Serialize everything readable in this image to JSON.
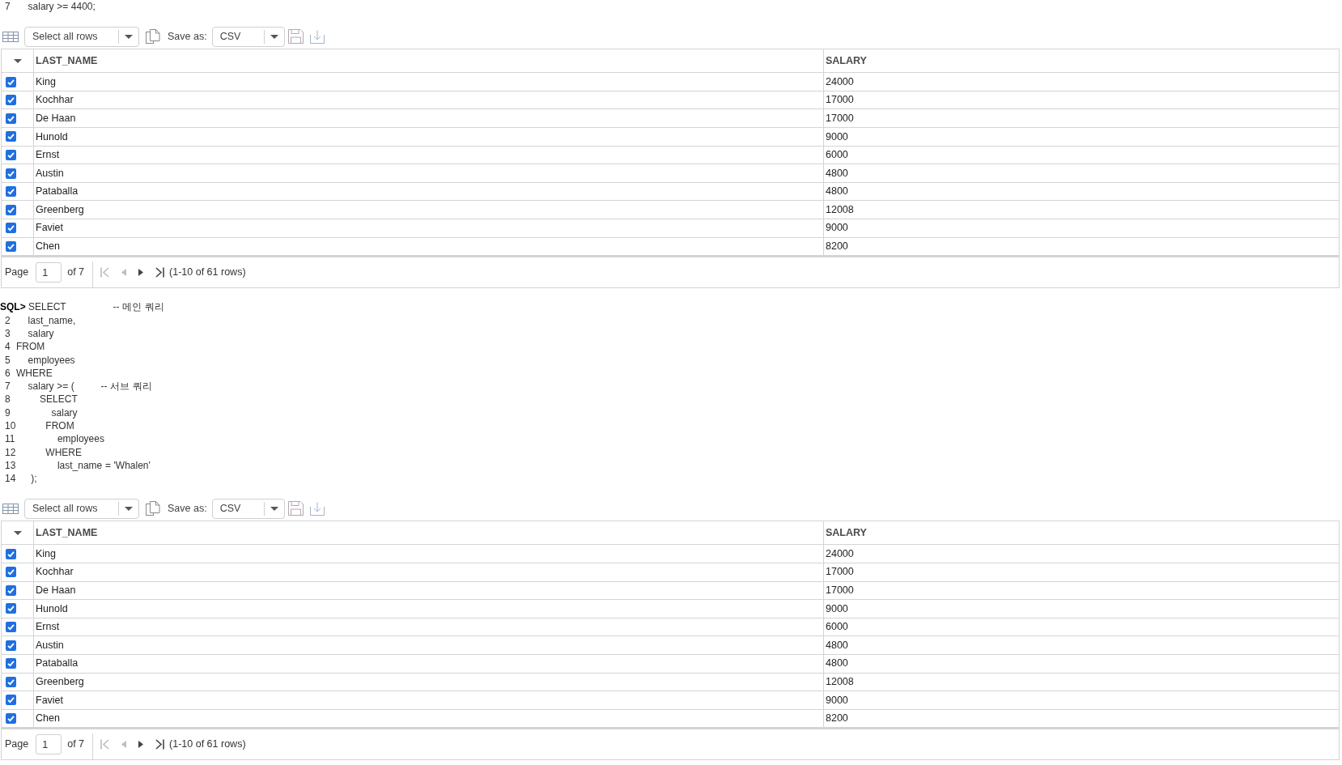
{
  "sections": [
    {
      "kind": "code",
      "lines": [
        {
          "kind": "numbered",
          "number": "7",
          "code": "    salary >= 4400;"
        }
      ]
    },
    {
      "kind": "result",
      "toolbar": {
        "row_selection": "Select all rows",
        "save_as_label": "Save as:",
        "save_format": "CSV"
      },
      "table": {
        "columns": [
          {
            "label": "LAST_NAME"
          },
          {
            "label": "SALARY"
          }
        ],
        "rows": [
          {
            "checked": true,
            "cells": [
              "King",
              "24000"
            ]
          },
          {
            "checked": true,
            "cells": [
              "Kochhar",
              "17000"
            ]
          },
          {
            "checked": true,
            "cells": [
              "De Haan",
              "17000"
            ]
          },
          {
            "checked": true,
            "cells": [
              "Hunold",
              "9000"
            ]
          },
          {
            "checked": true,
            "cells": [
              "Ernst",
              "6000"
            ]
          },
          {
            "checked": true,
            "cells": [
              "Austin",
              "4800"
            ]
          },
          {
            "checked": true,
            "cells": [
              "Pataballa",
              "4800"
            ]
          },
          {
            "checked": true,
            "cells": [
              "Greenberg",
              "12008"
            ]
          },
          {
            "checked": true,
            "cells": [
              "Faviet",
              "9000"
            ]
          },
          {
            "checked": true,
            "cells": [
              "Chen",
              "8200"
            ]
          }
        ]
      },
      "pagination": {
        "page_label": "Page",
        "page_value": "1",
        "page_total": "of 7",
        "nav": [
          {
            "kind": "first",
            "disabled": true
          },
          {
            "kind": "previous",
            "disabled": true
          },
          {
            "kind": "next",
            "disabled": false
          },
          {
            "kind": "last",
            "disabled": false
          }
        ],
        "summary": "(1-10 of 61 rows)"
      }
    },
    {
      "kind": "code",
      "lines": [
        {
          "kind": "prompt",
          "number": "SQL>",
          "code": "SELECT                -- 메인 쿼리"
        },
        {
          "kind": "numbered",
          "number": "2",
          "code": "    last_name,"
        },
        {
          "kind": "numbered",
          "number": "3",
          "code": "    salary"
        },
        {
          "kind": "numbered",
          "number": "4",
          "code": "FROM"
        },
        {
          "kind": "numbered",
          "number": "5",
          "code": "    employees"
        },
        {
          "kind": "numbered",
          "number": "6",
          "code": "WHERE"
        },
        {
          "kind": "numbered",
          "number": "7",
          "code": "    salary >= (         -- 서브 쿼리"
        },
        {
          "kind": "numbered",
          "number": "8",
          "code": "        SELECT"
        },
        {
          "kind": "numbered",
          "number": "9",
          "code": "            salary"
        },
        {
          "kind": "numbered",
          "number": "10",
          "code": "          FROM"
        },
        {
          "kind": "numbered",
          "number": "11",
          "code": "              employees"
        },
        {
          "kind": "numbered",
          "number": "12",
          "code": "          WHERE"
        },
        {
          "kind": "numbered",
          "number": "13",
          "code": "              last_name = 'Whalen'"
        },
        {
          "kind": "numbered",
          "number": "14",
          "code": "     );"
        }
      ]
    },
    {
      "kind": "result",
      "toolbar": {
        "row_selection": "Select all rows",
        "save_as_label": "Save as:",
        "save_format": "CSV"
      },
      "table": {
        "columns": [
          {
            "label": "LAST_NAME"
          },
          {
            "label": "SALARY"
          }
        ],
        "rows": [
          {
            "checked": true,
            "cells": [
              "King",
              "24000"
            ]
          },
          {
            "checked": true,
            "cells": [
              "Kochhar",
              "17000"
            ]
          },
          {
            "checked": true,
            "cells": [
              "De Haan",
              "17000"
            ]
          },
          {
            "checked": true,
            "cells": [
              "Hunold",
              "9000"
            ]
          },
          {
            "checked": true,
            "cells": [
              "Ernst",
              "6000"
            ]
          },
          {
            "checked": true,
            "cells": [
              "Austin",
              "4800"
            ]
          },
          {
            "checked": true,
            "cells": [
              "Pataballa",
              "4800"
            ]
          },
          {
            "checked": true,
            "cells": [
              "Greenberg",
              "12008"
            ]
          },
          {
            "checked": true,
            "cells": [
              "Faviet",
              "9000"
            ]
          },
          {
            "checked": true,
            "cells": [
              "Chen",
              "8200"
            ]
          }
        ]
      },
      "pagination": {
        "page_label": "Page",
        "page_value": "1",
        "page_total": "of 7",
        "nav": [
          {
            "kind": "first",
            "disabled": true
          },
          {
            "kind": "previous",
            "disabled": true
          },
          {
            "kind": "next",
            "disabled": false
          },
          {
            "kind": "last",
            "disabled": false
          }
        ],
        "summary": "(1-10 of 61 rows)"
      }
    }
  ]
}
